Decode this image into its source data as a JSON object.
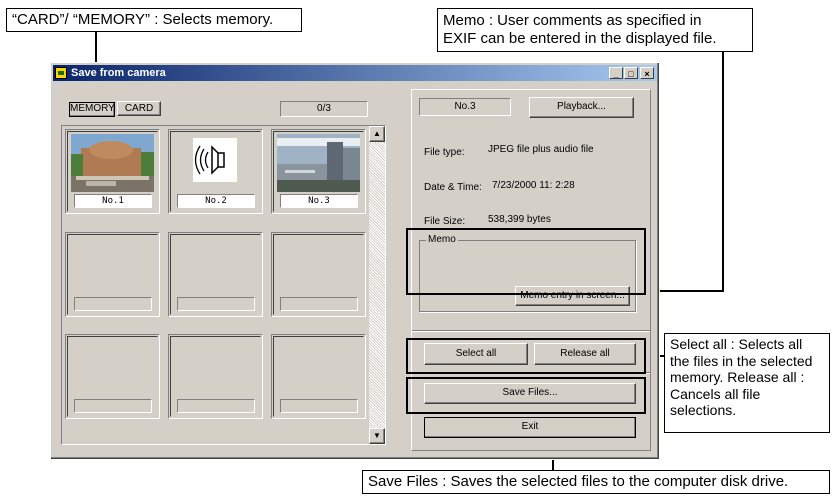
{
  "annotations": {
    "card_memory": "“CARD”/ “MEMORY” : Selects memory.",
    "memo_line1": "Memo : User comments as specified in",
    "memo_line2": "EXIF can be entered in the displayed file.",
    "select_all": "Select all : Selects all the files in the selected memory. Release all : Cancels all file selections.",
    "save_files": "Save Files : Saves the selected files to the computer disk drive."
  },
  "window": {
    "title": "Save from camera",
    "min_btn": "_",
    "max_btn": "□",
    "close_btn": "×"
  },
  "toolbar": {
    "memory_tab": "MEMORY",
    "card_tab": "CARD",
    "counter": "0/3"
  },
  "thumbnails": [
    {
      "label": "No.1"
    },
    {
      "label": "No.2"
    },
    {
      "label": "No.3"
    }
  ],
  "details": {
    "number": "No.3",
    "playback": "Playback...",
    "file_type_label": "File type:",
    "file_type_value": "JPEG file plus audio file",
    "datetime_label": "Date & Time:",
    "datetime_value": "7/23/2000  11: 2:28",
    "size_label": "File Size:",
    "size_value": "538,399 bytes"
  },
  "memo": {
    "title": "Memo",
    "entry_button": "Memo entry in screen..."
  },
  "actions": {
    "select_all": "Select all",
    "release_all": "Release all",
    "save_files": "Save Files...",
    "exit": "Exit"
  },
  "colors": {
    "face": "#d4d0c8",
    "titlebar_start": "#0a246a",
    "titlebar_end": "#a6caf0"
  }
}
